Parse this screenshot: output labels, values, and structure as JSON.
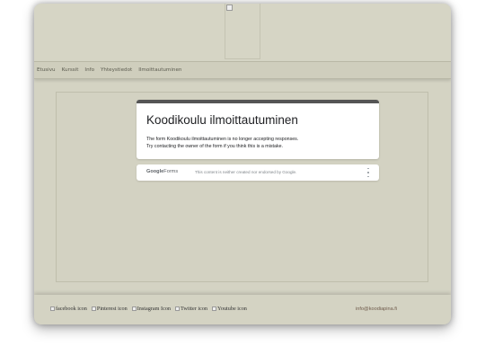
{
  "header": {
    "logo_alt": "",
    "logo_icon": "broken-image-icon"
  },
  "nav": {
    "items": [
      {
        "label": "Etusivu"
      },
      {
        "label": "Kurssit"
      },
      {
        "label": "Info"
      },
      {
        "label": "Yhteystiedot"
      },
      {
        "label": "Ilmoittautuminen"
      }
    ]
  },
  "form": {
    "title": "Koodikoulu ilmoittautuminen",
    "message_line1": "The form Koodikoulu ilmoittautuminen is no longer accepting responses.",
    "message_line2": "Try contacting the owner of the form if you think this is a mistake.",
    "accent_color": "#555555"
  },
  "forms_footer": {
    "brand_google": "Google",
    "brand_forms": "Forms",
    "disclaimer": "This content is neither created nor endorsed by Google.",
    "menu_icon": "kebab-menu-icon"
  },
  "footer": {
    "social": [
      {
        "alt": "facebook icon"
      },
      {
        "alt": "Pinterest icon"
      },
      {
        "alt": "Instagram Icon"
      },
      {
        "alt": "Twitter icon"
      },
      {
        "alt": "Youtube icon"
      }
    ],
    "email": "info@koodiapina.fi"
  },
  "colors": {
    "page_background": "#ffffff",
    "site_background": "#d4d3c3",
    "link_color": "#6f5b4b"
  }
}
